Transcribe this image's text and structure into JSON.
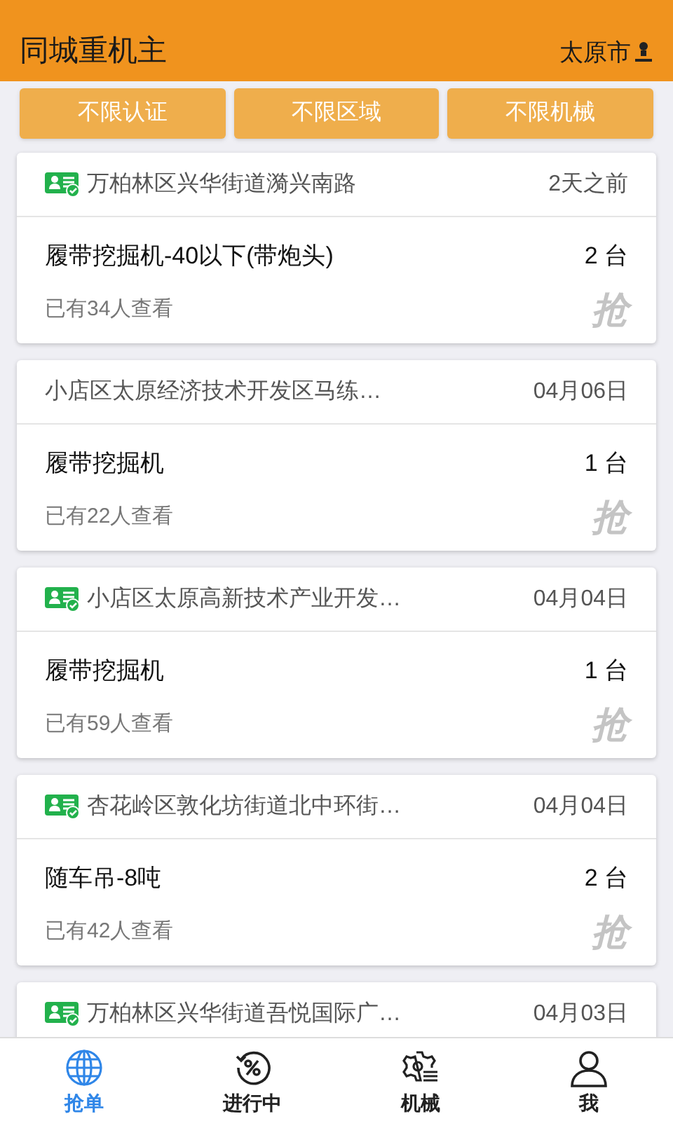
{
  "header": {
    "title": "同城重机主",
    "city": "太原市"
  },
  "filters": [
    {
      "label": "不限认证"
    },
    {
      "label": "不限区域"
    },
    {
      "label": "不限机械"
    }
  ],
  "orders": [
    {
      "verified": true,
      "address": "万柏林区兴华街道漪兴南路",
      "time": "2天之前",
      "machine": "履带挖掘机-40以下(带炮头)",
      "count": "2 台",
      "views": "已有34人查看",
      "grab": "抢"
    },
    {
      "verified": false,
      "address": "小店区太原经济技术开发区马练…",
      "time": "04月06日",
      "machine": "履带挖掘机",
      "count": "1 台",
      "views": "已有22人查看",
      "grab": "抢"
    },
    {
      "verified": true,
      "address": "小店区太原高新技术产业开发…",
      "time": "04月04日",
      "machine": "履带挖掘机",
      "count": "1 台",
      "views": "已有59人查看",
      "grab": "抢"
    },
    {
      "verified": true,
      "address": "杏花岭区敦化坊街道北中环街…",
      "time": "04月04日",
      "machine": "随车吊-8吨",
      "count": "2 台",
      "views": "已有42人查看",
      "grab": "抢"
    },
    {
      "verified": true,
      "address": "万柏林区兴华街道吾悦国际广…",
      "time": "04月03日"
    }
  ],
  "tabbar": [
    {
      "label": "抢单",
      "kind": "globe",
      "selected": true
    },
    {
      "label": "进行中",
      "kind": "percent",
      "selected": false
    },
    {
      "label": "机械",
      "kind": "gear",
      "selected": false
    },
    {
      "label": "我",
      "kind": "person",
      "selected": false
    }
  ]
}
